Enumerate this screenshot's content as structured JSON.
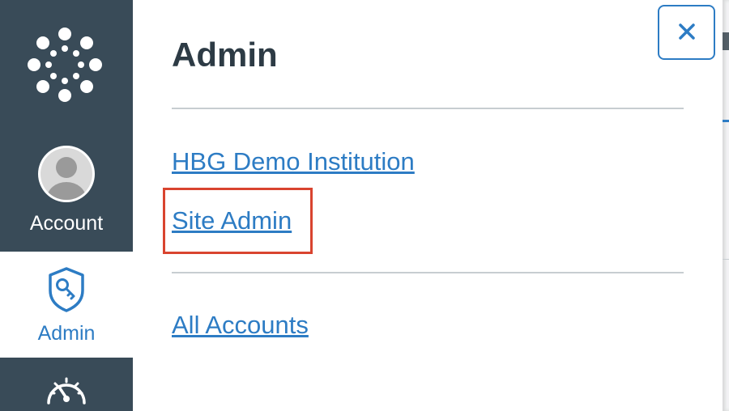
{
  "global_nav": {
    "logo_icon": "canvas-logo-icon",
    "account_label": "Account",
    "admin_label": "Admin",
    "dashboard_icon": "dashboard-icon"
  },
  "tray": {
    "title": "Admin",
    "links": [
      {
        "label": "HBG Demo Institution"
      },
      {
        "label": "Site Admin"
      },
      {
        "label": "All Accounts"
      }
    ],
    "close_icon": "close-icon"
  },
  "colors": {
    "nav_bg": "#394b58",
    "link": "#2d7cc4",
    "highlight": "#d9442f",
    "title": "#2d3b45"
  }
}
